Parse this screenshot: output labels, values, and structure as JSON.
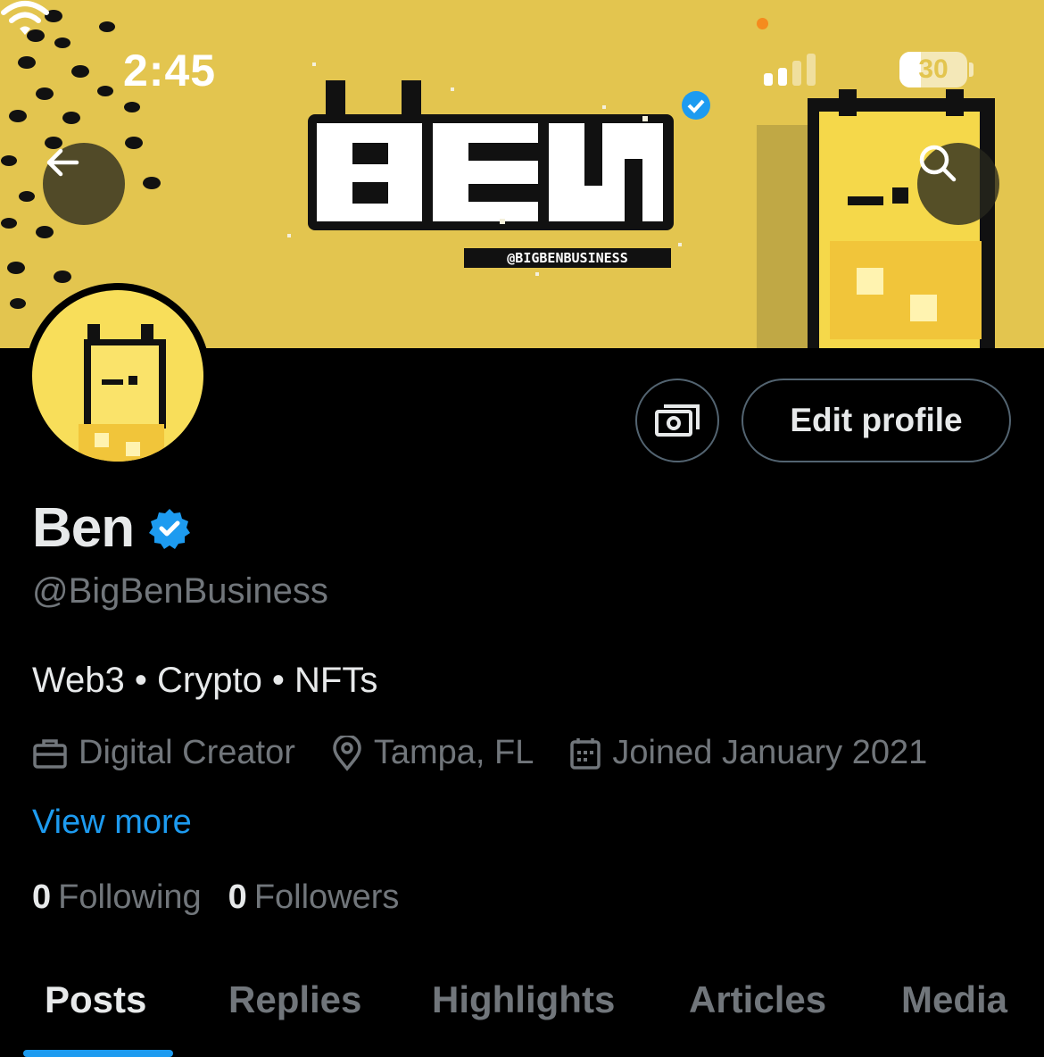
{
  "status_bar": {
    "time": "2:45",
    "battery": "30"
  },
  "banner": {
    "logo_text": "BEN",
    "banner_handle": "@BIGBENBUSINESS",
    "background_color": "#e3c54f"
  },
  "nav": {
    "back_icon": "arrow-left-icon",
    "search_icon": "search-icon"
  },
  "actions": {
    "tip_icon": "money-icon",
    "edit_label": "Edit profile"
  },
  "profile": {
    "name": "Ben",
    "verified": true,
    "handle": "@BigBenBusiness",
    "bio": "Web3 • Crypto • NFTs",
    "profession": "Digital Creator",
    "location": "Tampa, FL",
    "joined": "Joined January 2021",
    "view_more": "View more",
    "following_count": "0",
    "following_label": "Following",
    "followers_count": "0",
    "followers_label": "Followers"
  },
  "tabs": [
    {
      "label": "Posts",
      "active": true
    },
    {
      "label": "Replies",
      "active": false
    },
    {
      "label": "Highlights",
      "active": false
    },
    {
      "label": "Articles",
      "active": false
    },
    {
      "label": "Media",
      "active": false
    }
  ],
  "colors": {
    "accent": "#1d9bf0",
    "muted": "#71767b",
    "text": "#e7e9ea",
    "background": "#000000"
  }
}
